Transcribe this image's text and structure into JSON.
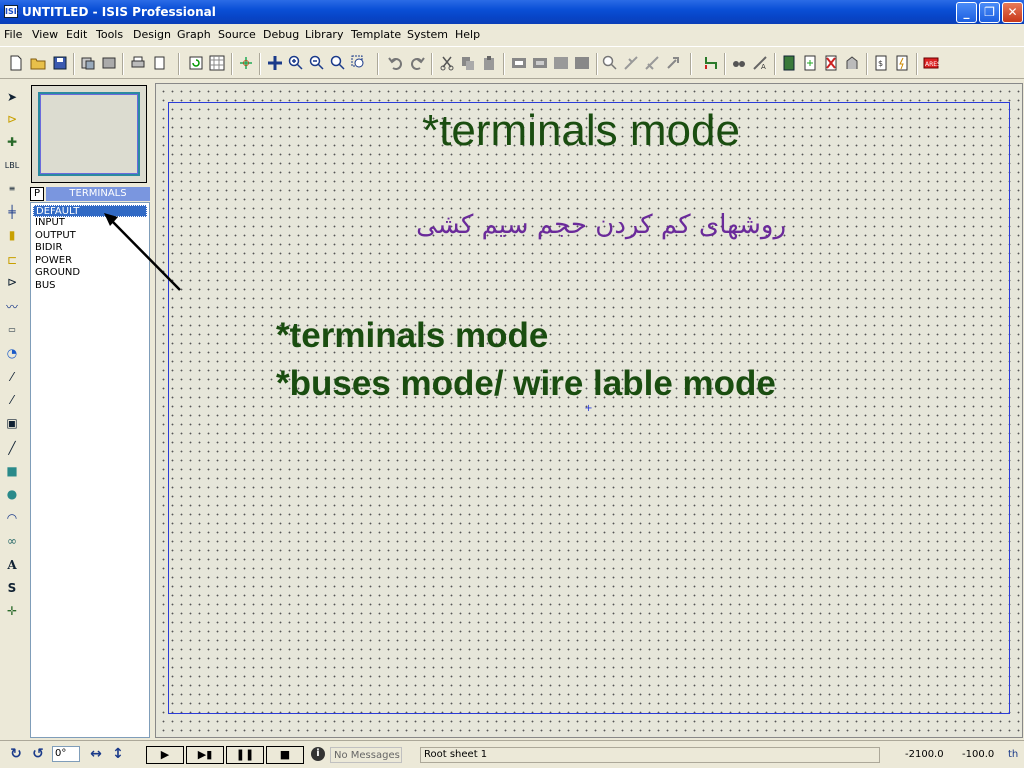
{
  "window": {
    "title": "UNTITLED - ISIS Professional",
    "icon_label": "ISIS",
    "buttons": {
      "minimize": "_",
      "maximize": "❐",
      "close": "✕"
    }
  },
  "menu": [
    "File",
    "View",
    "Edit",
    "Tools",
    "Design",
    "Graph",
    "Source",
    "Debug",
    "Library",
    "Template",
    "System",
    "Help"
  ],
  "selector": {
    "p_button": "P",
    "title": "TERMINALS",
    "items": [
      "DEFAULT",
      "INPUT",
      "OUTPUT",
      "BIDIR",
      "POWER",
      "GROUND",
      "BUS"
    ],
    "selected_index": 0
  },
  "canvas": {
    "title": "*terminals mode",
    "persian": "روشهای کم کردن حجم سیم کشی",
    "bullet1": "*terminals mode",
    "bullet2": "*buses mode/ wire lable mode",
    "colors": {
      "heading": "#1a4d10",
      "persian": "#6a2a9a",
      "sheet_border": "#2b3cd8"
    }
  },
  "status": {
    "rotation": "0°",
    "messages": "No Messages",
    "sheet": "Root sheet 1",
    "coord_x": "-2100.0",
    "coord_y": "-100.0",
    "unit": "th"
  }
}
